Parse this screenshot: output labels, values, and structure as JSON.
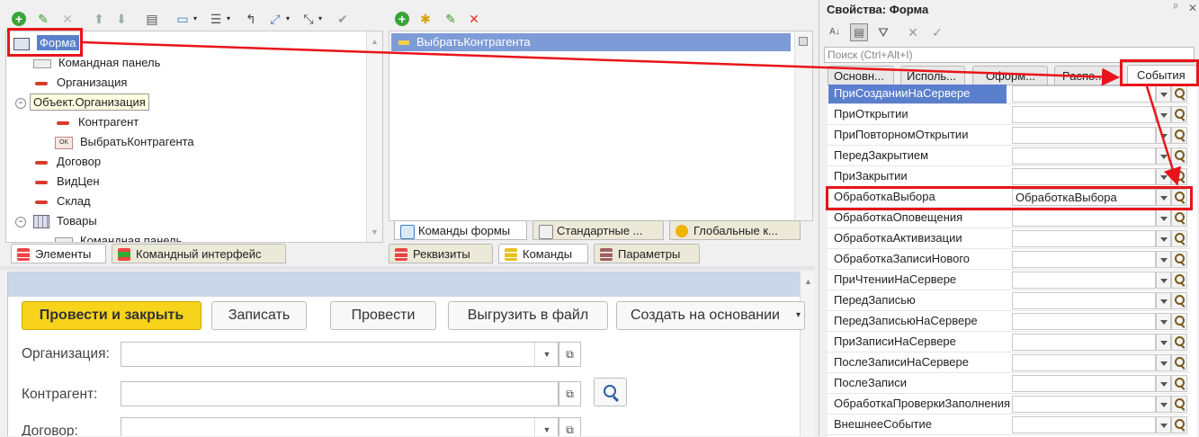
{
  "tree": {
    "items": [
      {
        "label": "Форма"
      },
      {
        "label": "Командная панель"
      },
      {
        "label": "Организация"
      },
      {
        "label": "Объект.Организация"
      },
      {
        "label": "Контрагент"
      },
      {
        "label": "ВыбратьКонтрагента"
      },
      {
        "label": "Договор"
      },
      {
        "label": "ВидЦен"
      },
      {
        "label": "Склад"
      },
      {
        "label": "Товары"
      },
      {
        "label": "Командная панель"
      }
    ],
    "tabs": [
      {
        "label": "Элементы"
      },
      {
        "label": "Командный интерфейс"
      }
    ]
  },
  "commands": {
    "selected": "ВыбратьКонтрагента",
    "subtabs": [
      {
        "label": "Команды формы"
      },
      {
        "label": "Стандартные ..."
      },
      {
        "label": "Глобальные к..."
      }
    ],
    "tabs": [
      {
        "label": "Реквизиты"
      },
      {
        "label": "Команды"
      },
      {
        "label": "Параметры"
      }
    ]
  },
  "preview": {
    "buttons": {
      "post_close": "Провести и закрыть",
      "save": "Записать",
      "post": "Провести",
      "export": "Выгрузить в файл",
      "create_based": "Создать на основании"
    },
    "fields": {
      "organization": "Организация:",
      "counterparty": "Контрагент:",
      "contract": "Договор:"
    }
  },
  "properties": {
    "title": "Свойства: Форма",
    "pin": "ᵖ",
    "search_placeholder": "Поиск (Ctrl+Alt+I)",
    "tabs": [
      {
        "label": "Основн..."
      },
      {
        "label": "Исполь..."
      },
      {
        "label": "Оформ..."
      },
      {
        "label": "Распо..."
      },
      {
        "label": "События"
      }
    ],
    "events": [
      {
        "name": "ПриСозданииНаСервере",
        "value": ""
      },
      {
        "name": "ПриОткрытии",
        "value": ""
      },
      {
        "name": "ПриПовторномОткрытии",
        "value": ""
      },
      {
        "name": "ПередЗакрытием",
        "value": ""
      },
      {
        "name": "ПриЗакрытии",
        "value": ""
      },
      {
        "name": "ОбработкаВыбора",
        "value": "ОбработкаВыбора"
      },
      {
        "name": "ОбработкаОповещения",
        "value": ""
      },
      {
        "name": "ОбработкаАктивизации",
        "value": ""
      },
      {
        "name": "ОбработкаЗаписиНового",
        "value": ""
      },
      {
        "name": "ПриЧтенииНаСервере",
        "value": ""
      },
      {
        "name": "ПередЗаписью",
        "value": ""
      },
      {
        "name": "ПередЗаписьюНаСервере",
        "value": ""
      },
      {
        "name": "ПриЗаписиНаСервере",
        "value": ""
      },
      {
        "name": "ПослеЗаписиНаСервере",
        "value": ""
      },
      {
        "name": "ПослеЗаписи",
        "value": ""
      },
      {
        "name": "ОбработкаПроверкиЗаполнения",
        "value": ""
      },
      {
        "name": "ВнешнееСобытие",
        "value": ""
      }
    ]
  },
  "colors": {
    "annotation": "#e8141a",
    "selection": "#5a7fcc",
    "primary_button": "#f7d31c"
  }
}
